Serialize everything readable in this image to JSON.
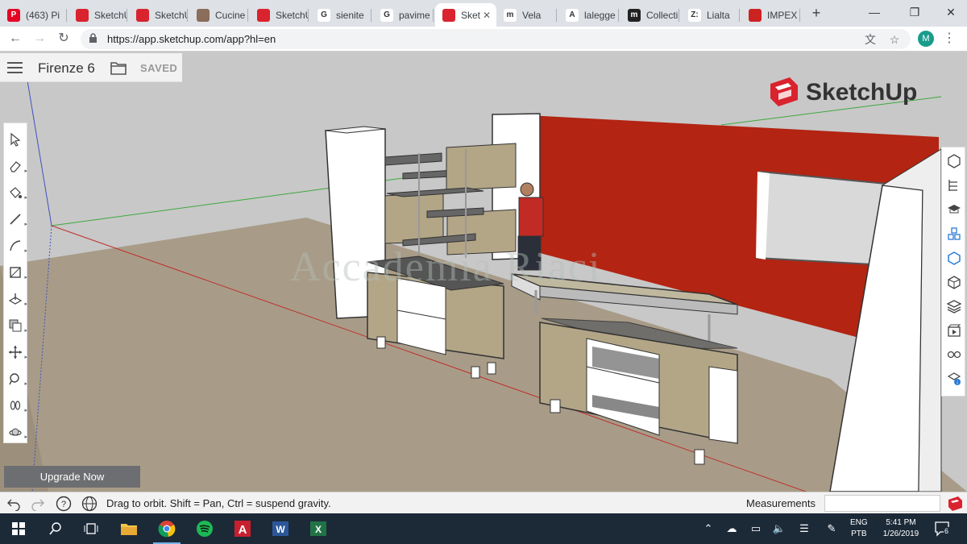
{
  "browser": {
    "tabs": [
      {
        "label": "(463) Pi",
        "favicon": "pinterest-icon",
        "color": "#e60023",
        "glyph": "P"
      },
      {
        "label": "SketchU",
        "favicon": "sketchup-icon",
        "color": "#d9232e",
        "glyph": ""
      },
      {
        "label": "SketchU",
        "favicon": "sketchup-icon",
        "color": "#d9232e",
        "glyph": ""
      },
      {
        "label": "Cucine",
        "favicon": "cucine-icon",
        "color": "#8a6d5a",
        "glyph": ""
      },
      {
        "label": "SketchU",
        "favicon": "sketchup-icon",
        "color": "#d9232e",
        "glyph": ""
      },
      {
        "label": "sienite",
        "favicon": "google-icon",
        "color": "#ffffff",
        "glyph": "G"
      },
      {
        "label": "pavime",
        "favicon": "google-icon",
        "color": "#ffffff",
        "glyph": "G"
      },
      {
        "label": "Sket",
        "favicon": "sketchup-icon",
        "color": "#d9232e",
        "glyph": "",
        "active": true
      },
      {
        "label": "Vela",
        "favicon": "m-icon",
        "color": "#ffffff",
        "glyph": "m"
      },
      {
        "label": "lalegge",
        "favicon": "a-icon",
        "color": "#ffffff",
        "glyph": "A"
      },
      {
        "label": "Collecti",
        "favicon": "m-circle-icon",
        "color": "#222222",
        "glyph": "m"
      },
      {
        "label": "Lialta",
        "favicon": "z-icon",
        "color": "#ffffff",
        "glyph": "Z:"
      },
      {
        "label": "IMPEX",
        "favicon": "impex-icon",
        "color": "#cc2222",
        "glyph": ""
      }
    ],
    "url": "https://app.sketchup.com/app?hl=en",
    "profile_initial": "M"
  },
  "app": {
    "model_name": "Firenze 6",
    "save_status": "SAVED",
    "logo_text": "SketchUp",
    "watermark": "Accademia Riaci",
    "upgrade_label": "Upgrade Now",
    "left_tools": [
      "select-tool",
      "eraser-tool",
      "paint-tool",
      "line-tool",
      "arc-tool",
      "rectangle-tool",
      "push-pull-tool",
      "offset-tool",
      "move-tool",
      "tape-measure-tool",
      "walk-tool",
      "orbit-tool"
    ],
    "right_panels": [
      "entity-info-panel",
      "outliner-panel",
      "instructor-panel",
      "components-panel",
      "3d-warehouse-panel",
      "materials-panel",
      "layers-panel",
      "scenes-panel",
      "display-panel",
      "model-info-panel"
    ],
    "status_hint": "Drag to orbit. Shift = Pan, Ctrl = suspend gravity.",
    "measurements_label": "Measurements",
    "measurements_value": ""
  },
  "taskbar": {
    "apps": [
      "start",
      "search",
      "task-view",
      "file-explorer",
      "chrome",
      "spotify",
      "autocad",
      "word",
      "excel"
    ],
    "lang_top": "ENG",
    "lang_bottom": "PTB",
    "time": "5:41 PM",
    "date": "1/26/2019",
    "notification_count": "6"
  },
  "colors": {
    "sketchup_red": "#d9232e",
    "wall_red": "#b32412",
    "floor": "#a89c88",
    "sky": "#c8c8c8",
    "wood": "#b3a687",
    "taskbar": "#1c2a38"
  }
}
